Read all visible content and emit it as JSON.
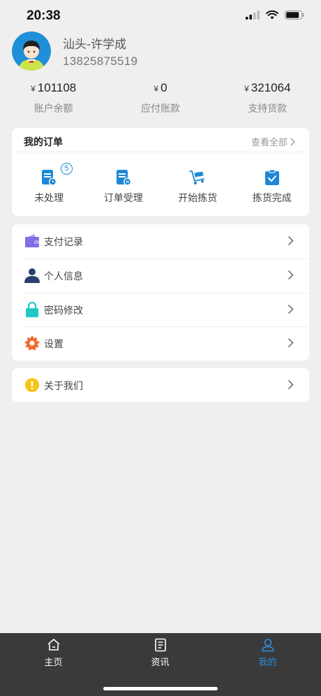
{
  "status_bar": {
    "time": "20:38"
  },
  "profile": {
    "name": "汕头-许学成",
    "phone": "13825875519"
  },
  "stats": [
    {
      "currency": "¥",
      "value": "101108",
      "label": "账户余额"
    },
    {
      "currency": "¥",
      "value": "0",
      "label": "应付账款"
    },
    {
      "currency": "¥",
      "value": "321064",
      "label": "支持货款"
    }
  ],
  "orders": {
    "title": "我的订单",
    "view_all": "查看全部",
    "items": [
      {
        "label": "未处理",
        "icon": "pending-order-icon",
        "badge": "5"
      },
      {
        "label": "订单受理",
        "icon": "order-accepted-icon"
      },
      {
        "label": "开始拣货",
        "icon": "picking-cart-icon"
      },
      {
        "label": "拣货完成",
        "icon": "picking-done-icon"
      }
    ]
  },
  "menu": [
    {
      "label": "支付记录",
      "icon": "wallet-icon"
    },
    {
      "label": "个人信息",
      "icon": "person-icon"
    },
    {
      "label": "密码修改",
      "icon": "lock-icon"
    },
    {
      "label": "设置",
      "icon": "gear-icon"
    }
  ],
  "about": {
    "label": "关于我们",
    "icon": "info-icon"
  },
  "tabbar": {
    "tabs": [
      {
        "label": "主页",
        "icon": "home-icon"
      },
      {
        "label": "资讯",
        "icon": "news-icon"
      },
      {
        "label": "我的",
        "icon": "user-icon",
        "active": true
      }
    ]
  },
  "colors": {
    "accent": "#1e88d6",
    "tabbar_bg": "#3a3a3a",
    "active_tab": "#2a8fe0",
    "page_bg": "#efefef"
  }
}
